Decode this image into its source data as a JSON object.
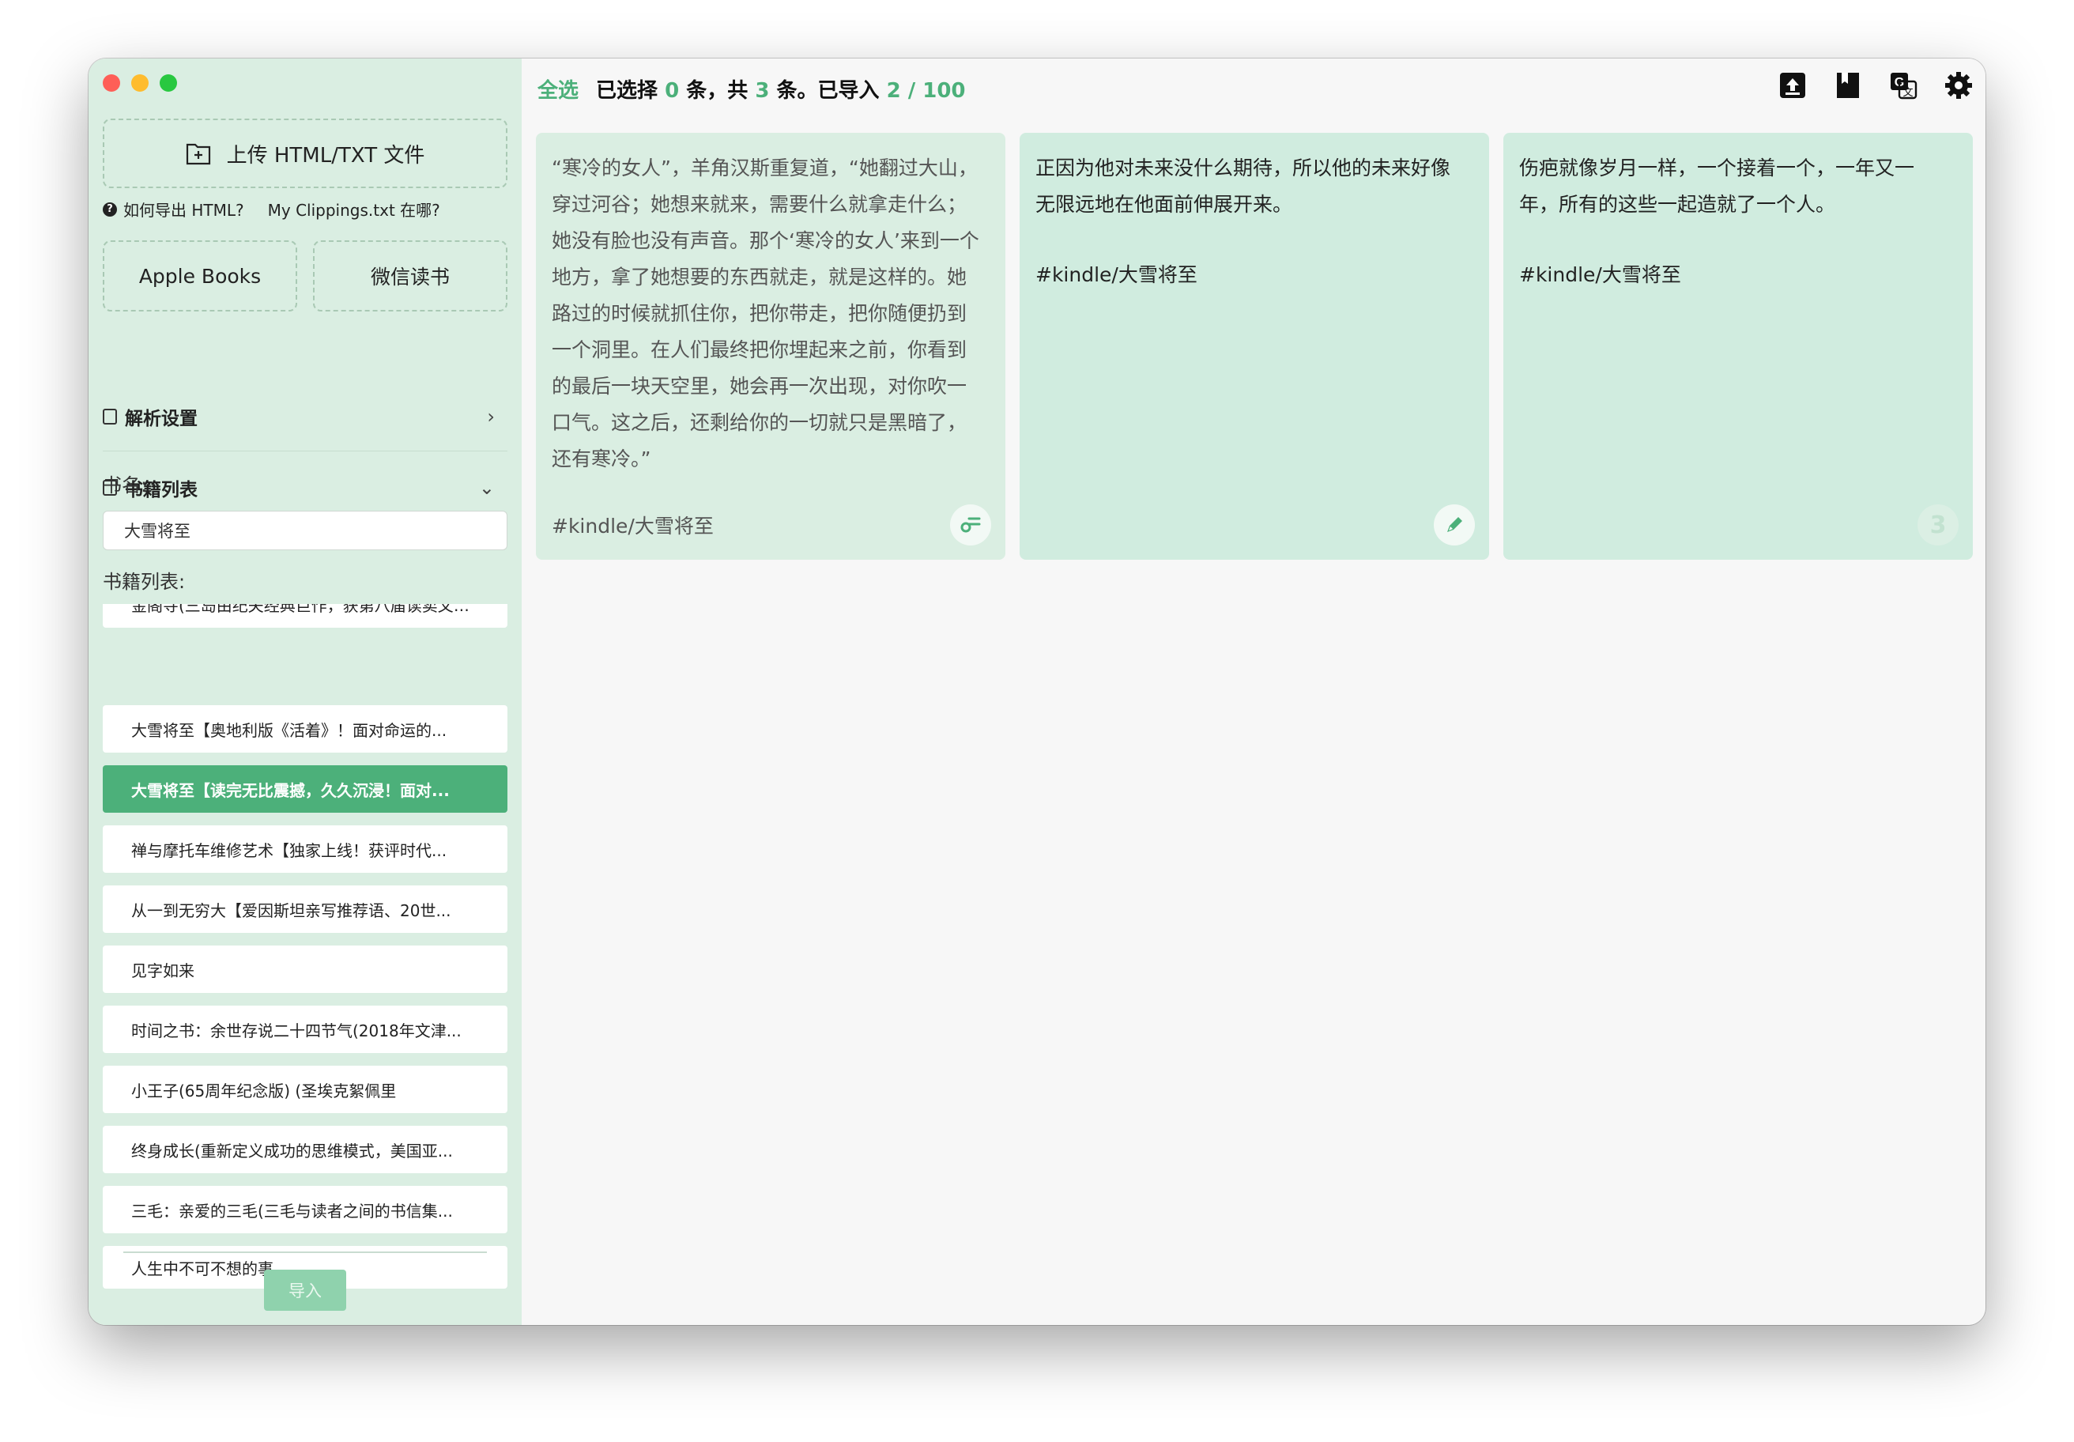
{
  "sidebar": {
    "upload_label": "上传 HTML/TXT 文件",
    "help_export_html": "如何导出 HTML?",
    "help_clippings": "My Clippings.txt 在哪?",
    "source_apple": "Apple Books",
    "source_wechat": "微信读书",
    "parse_settings": "解析设置",
    "book_section": "书籍列表",
    "name_label": "书名:",
    "name_value": "大雪将至",
    "list_label": "书籍列表:",
    "books": [
      "金阁寺(三岛由纪夫经典巨作，获第八届读卖文学奖...",
      "大雪将至【奥地利版《活着》！面对命运的...",
      "大雪将至【读完无比震撼，久久沉浸！面对...",
      "禅与摩托车维修艺术【独家上线！获评时代...",
      "从一到无穷大【爱因斯坦亲写推荐语、20世...",
      "见字如来",
      "时间之书：余世存说二十四节气(2018年文津...",
      "小王子(65周年纪念版) (圣埃克絮佩里",
      "终身成长(重新定义成功的思维模式，美国亚...",
      "三毛：亲爱的三毛(三毛与读者之间的书信集...",
      "人生中不可不想的事"
    ],
    "active_index": 2,
    "import_label": "导入"
  },
  "topbar": {
    "select_all": "全选",
    "selected_prefix": "已选择",
    "selected_count": "0",
    "sep1": "条，共",
    "total_count": "3",
    "sep2": "条。已导入",
    "imported": "2 / 100"
  },
  "toolbar_icons": [
    "upload-icon",
    "book-icon",
    "translate-icon",
    "gear-icon"
  ],
  "cards": [
    {
      "text": "“寒冷的女人”，羊角汉斯重复道，“她翻过大山，\n穿过河谷；她想来就来，需要什么就拿走什么；\n她没有脸也没有声音。那个‘寒冷的女人’来到一个\n地方，拿了她想要的东西就走，就是这样的。她\n路过的时候就抓住你，把你带走，把你随便扔到\n一个洞里。在人们最终把你埋起来之前，你看到\n的最后一块天空里，她会再一次出现，对你吹一\n口气。这之后，还剩给你的一切就只是黑暗了，\n还有寒冷。”",
      "tag": "#kindle/大雪将至",
      "badge_icon": "link-icon"
    },
    {
      "text": "正因为他对未来没什么期待，所以他的未来好像\n无限远地在他面前伸展开来。",
      "tag": "#kindle/大雪将至",
      "badge_icon": "pencil-icon"
    },
    {
      "text": "伤疤就像岁月一样，一个接着一个，一年又一\n年，所有的这些一起造就了一个人。",
      "tag": "#kindle/大雪将至",
      "badge": "3"
    }
  ],
  "colors": {
    "accent": "#4cb07a",
    "sidebar_bg": "#daeee2",
    "card_bg": "#d0ecdf"
  }
}
